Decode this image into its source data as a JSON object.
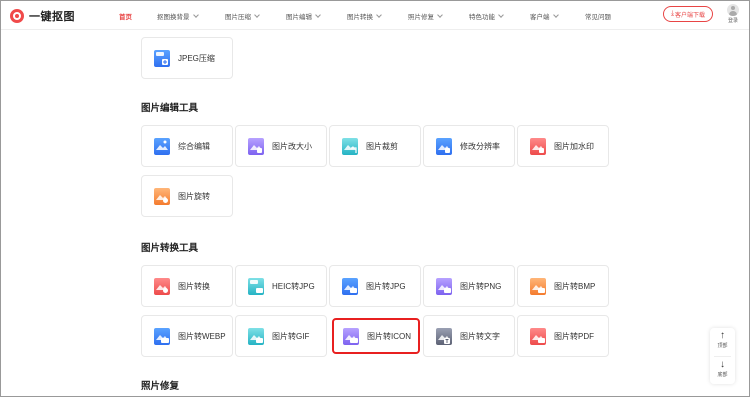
{
  "header": {
    "logo_text": "一键抠图",
    "nav": [
      {
        "label": "首页",
        "active": true,
        "dropdown": false
      },
      {
        "label": "抠图换背景",
        "dropdown": true
      },
      {
        "label": "图片压缩",
        "dropdown": true
      },
      {
        "label": "图片编辑",
        "dropdown": true
      },
      {
        "label": "图片转换",
        "dropdown": true
      },
      {
        "label": "照片修复",
        "dropdown": true
      },
      {
        "label": "特色功能",
        "dropdown": true
      },
      {
        "label": "客户端",
        "dropdown": true
      },
      {
        "label": "常见问题",
        "dropdown": false
      }
    ],
    "download_label": "客户端下载",
    "user_label": "登录"
  },
  "top_card": {
    "label": "JPEG压缩",
    "icon": "jpeg-compress-icon"
  },
  "sections": [
    {
      "title": "图片编辑工具",
      "cards": [
        {
          "label": "综合编辑",
          "icon": "edit-icon"
        },
        {
          "label": "图片改大小",
          "icon": "resize-icon"
        },
        {
          "label": "图片裁剪",
          "icon": "crop-icon"
        },
        {
          "label": "修改分辨率",
          "icon": "resolution-icon"
        },
        {
          "label": "图片加水印",
          "icon": "watermark-icon"
        },
        {
          "label": "图片旋转",
          "icon": "rotate-icon"
        }
      ]
    },
    {
      "title": "图片转换工具",
      "cards": [
        {
          "label": "图片转换",
          "icon": "convert-icon"
        },
        {
          "label": "HEIC转JPG",
          "icon": "heic-jpg-icon"
        },
        {
          "label": "图片转JPG",
          "icon": "to-jpg-icon"
        },
        {
          "label": "图片转PNG",
          "icon": "to-png-icon"
        },
        {
          "label": "图片转BMP",
          "icon": "to-bmp-icon"
        },
        {
          "label": "图片转WEBP",
          "icon": "to-webp-icon"
        },
        {
          "label": "图片转GIF",
          "icon": "to-gif-icon"
        },
        {
          "label": "图片转ICON",
          "icon": "to-icon-icon",
          "highlighted": true
        },
        {
          "label": "图片转文字",
          "icon": "to-text-icon"
        },
        {
          "label": "图片转PDF",
          "icon": "to-pdf-icon"
        }
      ]
    },
    {
      "title": "照片修复",
      "cards": []
    }
  ],
  "float": {
    "top_label": "顶部",
    "bottom_label": "底部"
  },
  "colors": {
    "brand": "#e84545",
    "highlight_border": "#e82020",
    "blue": "#2f7cf6",
    "purple": "#8b6cf6",
    "cyan": "#29b8c8",
    "orange": "#f58a3a",
    "red": "#f05252",
    "gray": "#6b6f80"
  }
}
